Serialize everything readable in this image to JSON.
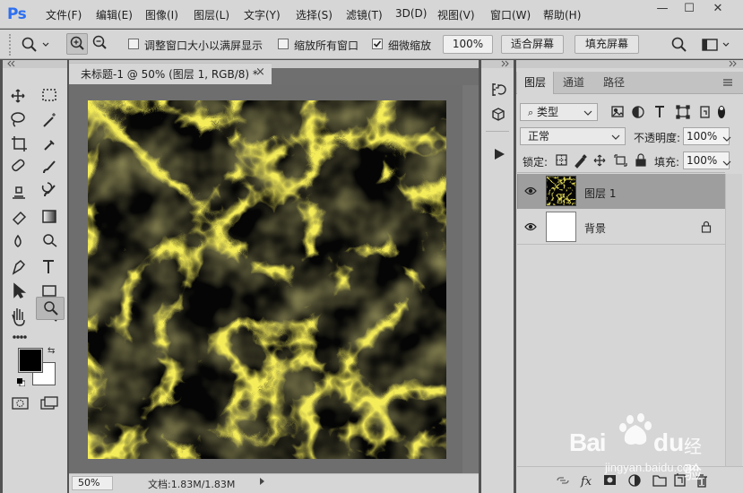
{
  "app": {
    "logo": "Ps"
  },
  "menu": [
    "文件(F)",
    "编辑(E)",
    "图像(I)",
    "图层(L)",
    "文字(Y)",
    "选择(S)",
    "滤镜(T)",
    "3D(D)",
    "视图(V)",
    "窗口(W)",
    "帮助(H)"
  ],
  "window_controls": {
    "minimize": "—",
    "maximize": "☐",
    "close": "✕"
  },
  "options": {
    "resize_windows_label": "调整窗口大小以满屏显示",
    "resize_windows_checked": false,
    "zoom_all_label": "缩放所有窗口",
    "zoom_all_checked": false,
    "scrubby_label": "细微缩放",
    "scrubby_checked": true,
    "zoom_value": "100%",
    "fit_screen_label": "适合屏幕",
    "fill_screen_label": "填充屏幕"
  },
  "document": {
    "tab_title": "未标题-1 @ 50% (图层 1, RGB/8) *",
    "tab_close": "×",
    "zoom": "50%",
    "doc_size": "文档:1.83M/1.83M"
  },
  "layers_panel": {
    "tabs": [
      "图层",
      "通道",
      "路径"
    ],
    "active_tab": "图层",
    "filter_kind": "类型",
    "blend_mode": "正常",
    "opacity_label": "不透明度:",
    "opacity_value": "100%",
    "lock_label": "锁定:",
    "fill_label": "填充:",
    "fill_value": "100%",
    "layers": [
      {
        "name": "图层 1",
        "selected": true,
        "visible": true,
        "locked": false
      },
      {
        "name": "背景",
        "selected": false,
        "visible": true,
        "locked": true
      }
    ]
  },
  "watermark": {
    "brand": "Bai",
    "brand2": "du",
    "sub": "经验",
    "url": "jingyan.baidu.com"
  },
  "colors": {
    "foreground": "#000000",
    "background": "#ffffff",
    "accent_logo": "#2d6ff0",
    "clouds_color": "#e8d51a"
  }
}
